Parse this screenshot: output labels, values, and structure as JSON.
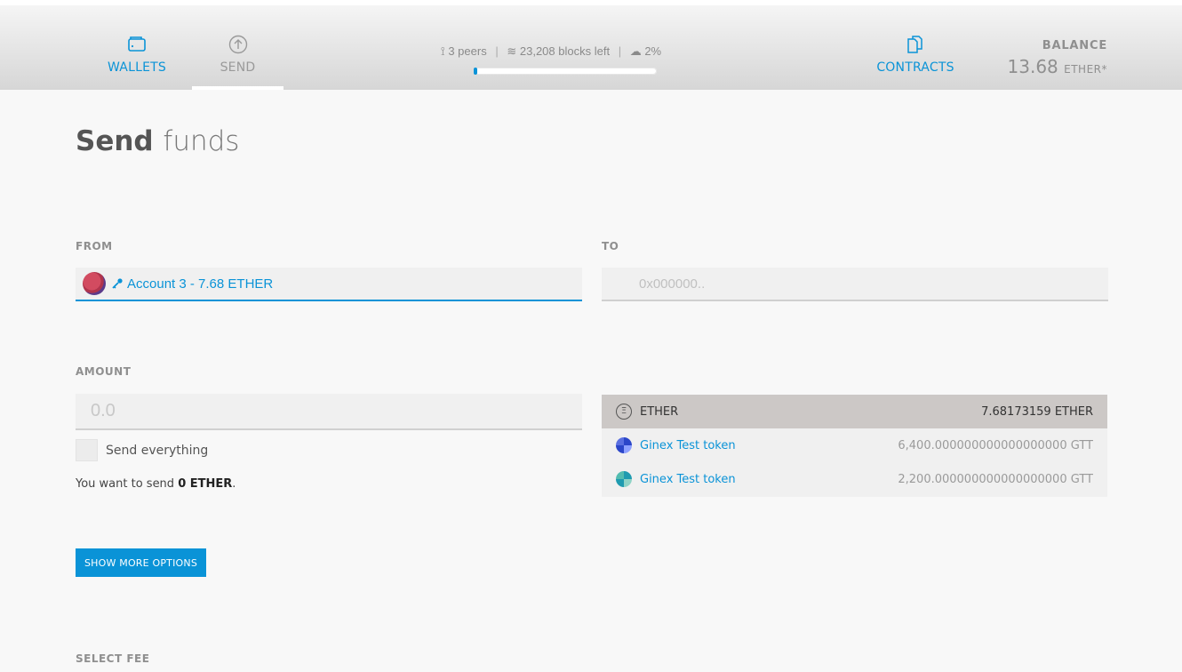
{
  "nav": {
    "wallets_label": "WALLETS",
    "send_label": "SEND",
    "contracts_label": "CONTRACTS"
  },
  "status": {
    "peers": "3 peers",
    "blocks_left": "23,208 blocks left",
    "sync_percent": "2%",
    "sync_fraction": 0.02
  },
  "balance": {
    "label": "BALANCE",
    "value": "13.68",
    "unit": "ETHER*"
  },
  "page": {
    "title_bold": "Send",
    "title_light": "funds"
  },
  "from": {
    "label": "FROM",
    "account_text": "Account 3 - 7.68 ETHER"
  },
  "to": {
    "label": "TO",
    "placeholder": "0x000000.."
  },
  "amount": {
    "label": "AMOUNT",
    "placeholder": "0.0",
    "send_everything_label": "Send everything",
    "summary_prefix": "You want to send ",
    "summary_amount": "0 ETHER",
    "summary_suffix": "."
  },
  "tokens": [
    {
      "name": "ETHER",
      "balance": "7.68173159 ETHER",
      "icon": "ether-icon",
      "selected": true
    },
    {
      "name": "Ginex Test token",
      "balance": "6,400.000000000000000000 GTT",
      "icon": "token-identicon"
    },
    {
      "name": "Ginex Test token",
      "balance": "2,200.000000000000000000 GTT",
      "icon": "token-identicon"
    }
  ],
  "actions": {
    "more_options_label": "SHOW MORE OPTIONS"
  },
  "fee": {
    "label": "SELECT FEE"
  },
  "colors": {
    "accent": "#0a93d7",
    "muted_text": "#8f8f8f",
    "selected_row": "#ccc8c6"
  }
}
